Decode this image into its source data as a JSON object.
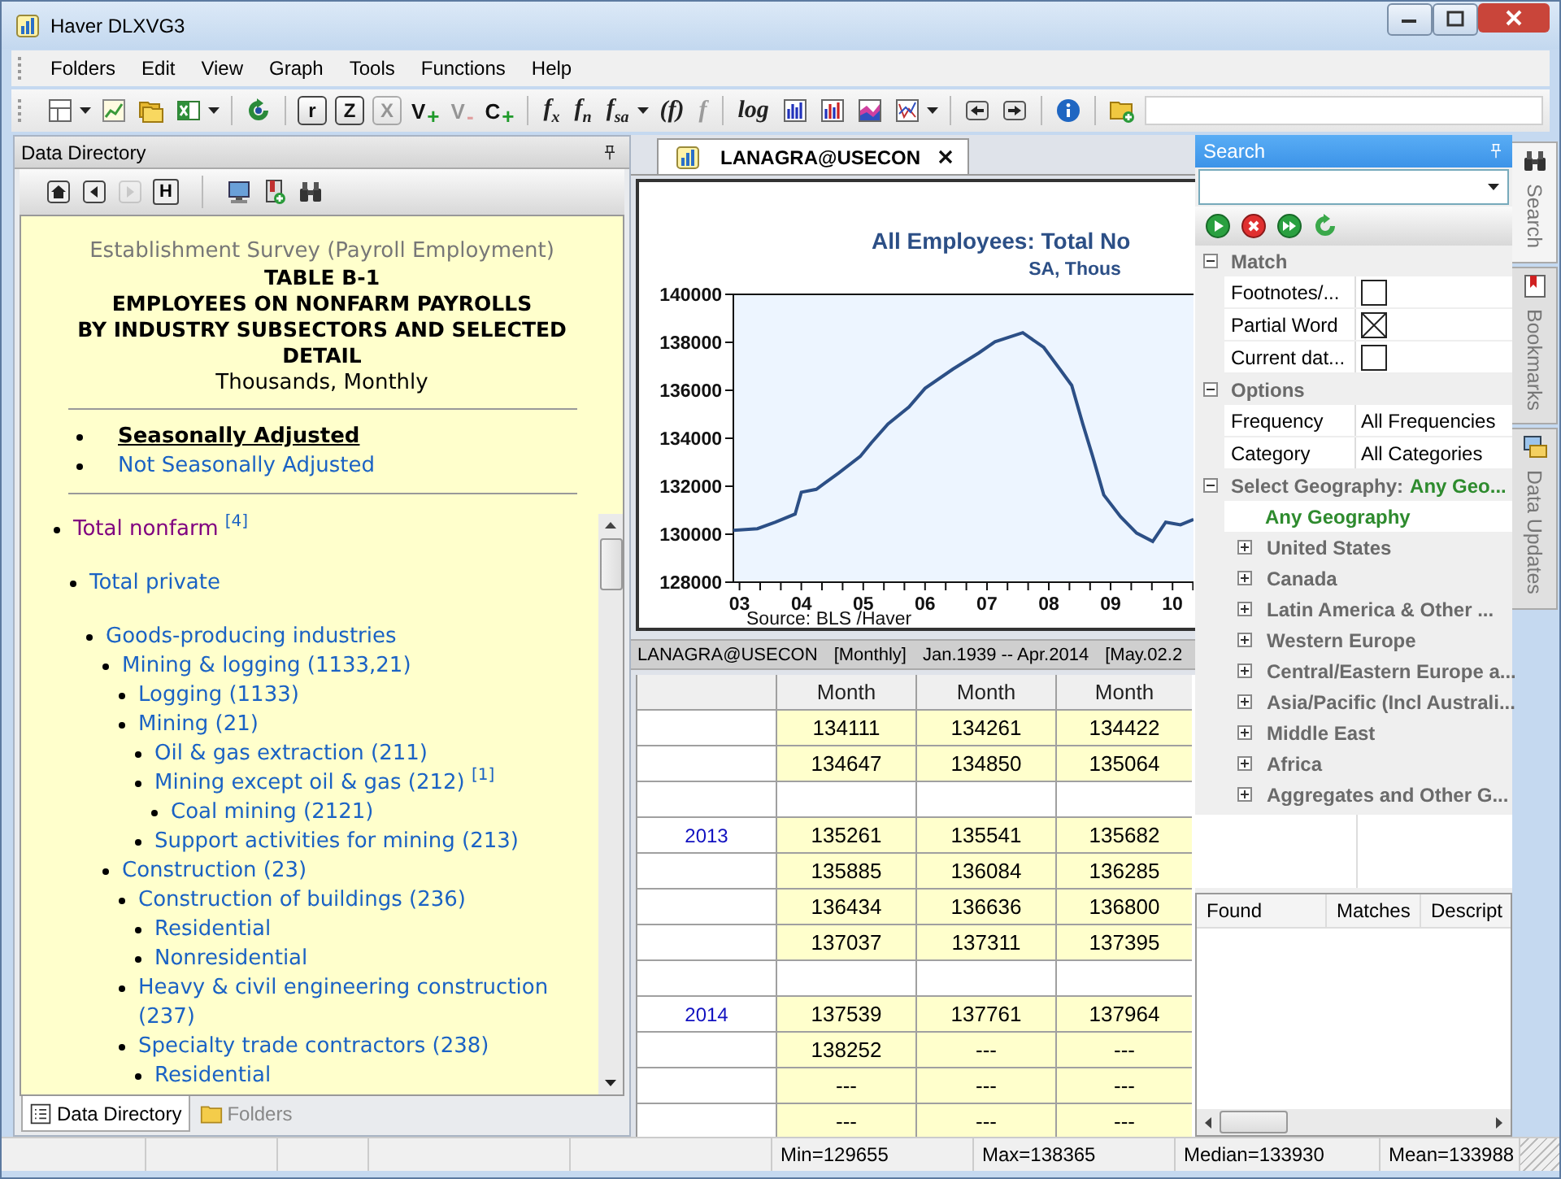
{
  "window": {
    "title": "Haver DLXVG3"
  },
  "menu": [
    "Folders",
    "Edit",
    "View",
    "Graph",
    "Tools",
    "Functions",
    "Help"
  ],
  "toolbar": [
    {
      "kind": "icon",
      "caret": true,
      "disabled": false
    },
    {
      "kind": "icon",
      "caret": false,
      "disabled": false
    },
    {
      "kind": "icon",
      "caret": false,
      "disabled": false
    },
    {
      "kind": "icon",
      "caret": true,
      "disabled": false
    },
    {
      "kind": "separator"
    },
    {
      "kind": "icon",
      "caret": false,
      "disabled": false
    },
    {
      "kind": "separator"
    },
    {
      "kind": "key",
      "label": "r",
      "caret": false,
      "disabled": false
    },
    {
      "kind": "key",
      "label": "Z",
      "caret": false,
      "disabled": false
    },
    {
      "kind": "key",
      "label": "X",
      "caret": false,
      "disabled": true
    },
    {
      "kind": "sign",
      "label": "V",
      "sign": "+",
      "caret": false,
      "disabled": false
    },
    {
      "kind": "sign",
      "label": "V",
      "sign": "-",
      "caret": false,
      "disabled": true
    },
    {
      "kind": "sign",
      "label": "C",
      "sign": "+",
      "caret": false,
      "disabled": false
    },
    {
      "kind": "separator"
    },
    {
      "kind": "func",
      "label": "f$_{x}$",
      "caret": false,
      "disabled": false
    },
    {
      "kind": "func",
      "label": "f$_{n}$",
      "caret": false,
      "disabled": false
    },
    {
      "kind": "func",
      "label": "f$_{sa}$",
      "caret": true,
      "disabled": false
    },
    {
      "kind": "func",
      "label": "(f)",
      "caret": false,
      "disabled": false
    },
    {
      "kind": "func",
      "label": "f",
      "caret": false,
      "disabled": true
    },
    {
      "kind": "separator"
    },
    {
      "kind": "func",
      "label": "log",
      "caret": false,
      "disabled": false
    },
    {
      "kind": "icon",
      "caret": false,
      "disabled": false
    },
    {
      "kind": "icon",
      "caret": false,
      "disabled": false
    },
    {
      "kind": "icon",
      "caret": false,
      "disabled": false
    },
    {
      "kind": "icon",
      "caret": true,
      "disabled": false
    },
    {
      "kind": "separator"
    },
    {
      "kind": "icon",
      "caret": false,
      "disabled": false
    },
    {
      "kind": "icon",
      "caret": false,
      "disabled": false
    },
    {
      "kind": "separator"
    },
    {
      "kind": "icon",
      "caret": false,
      "disabled": false
    },
    {
      "kind": "separator"
    },
    {
      "kind": "icon",
      "caret": false,
      "disabled": false
    }
  ],
  "data_directory": {
    "title": "Data Directory",
    "nav": [
      {
        "kind": "icon",
        "disabled": false
      },
      {
        "kind": "icon",
        "disabled": false
      },
      {
        "kind": "icon",
        "disabled": true
      },
      {
        "kind": "key",
        "label": "H",
        "disabled": false
      },
      {
        "kind": "separator"
      },
      {
        "kind": "icon",
        "disabled": false
      },
      {
        "kind": "icon",
        "disabled": false
      },
      {
        "kind": "icon",
        "disabled": false
      }
    ],
    "survey": "Establishment Survey (Payroll Employment)",
    "heading": [
      "TABLE B-1",
      "EMPLOYEES ON NONFARM PAYROLLS",
      "BY INDUSTRY SUBSECTORS AND SELECTED DETAIL"
    ],
    "units": "Thousands, Monthly",
    "adjustments": [
      {
        "label": "Seasonally Adjusted",
        "selected": true
      },
      {
        "label": "Not Seasonally Adjusted",
        "selected": false
      }
    ],
    "tree": [
      {
        "label": "Total nonfarm $^{[4]}$",
        "visited": true,
        "children": [
          {
            "label": "Total private",
            "visited": false,
            "children": [
              {
                "label": "Goods-producing industries",
                "visited": false,
                "children": [
                  {
                    "label": "Mining & logging (1133,21)",
                    "visited": false,
                    "children": [
                      {
                        "label": "Logging (1133)",
                        "visited": false
                      },
                      {
                        "label": "Mining (21)",
                        "visited": false,
                        "children": [
                          {
                            "label": "Oil & gas extraction (211)",
                            "visited": false
                          },
                          {
                            "label": "Mining except oil & gas (212) $^{[1]}$",
                            "visited": false,
                            "children": [
                              {
                                "label": "Coal mining (2121)",
                                "visited": false
                              }
                            ]
                          },
                          {
                            "label": "Support activities for mining (213)",
                            "visited": false
                          }
                        ]
                      }
                    ]
                  },
                  {
                    "label": "Construction (23)",
                    "visited": false,
                    "children": [
                      {
                        "label": "Construction of buildings (236)",
                        "visited": false,
                        "children": [
                          {
                            "label": "Residential",
                            "visited": false
                          },
                          {
                            "label": "Nonresidential",
                            "visited": false
                          }
                        ]
                      },
                      {
                        "label": "Heavy & civil engineering construction (237)",
                        "visited": false
                      },
                      {
                        "label": "Specialty trade contractors (238)",
                        "visited": false,
                        "children": [
                          {
                            "label": "Residential",
                            "visited": false
                          }
                        ]
                      }
                    ]
                  }
                ]
              }
            ]
          }
        ]
      }
    ],
    "panel_tabs": [
      {
        "label": "Data Directory",
        "selected": true
      },
      {
        "label": "Folders",
        "selected": false
      }
    ]
  },
  "series_tab": {
    "label": "LANAGRA@USECON",
    "selected": true
  },
  "chart": {
    "subtitle": "SA, Thous",
    "source": "Source:  BLS /Haver",
    "chart_data": {
      "type": "line",
      "title": "All Employees: Total No",
      "x": [
        2.9,
        3.29,
        3.58,
        3.9,
        4.0,
        4.24,
        4.6,
        4.95,
        5.13,
        5.4,
        5.74,
        6.0,
        6.45,
        6.87,
        7.13,
        7.58,
        7.92,
        8.18,
        8.37,
        8.55,
        8.71,
        8.89,
        9.16,
        9.42,
        9.68,
        9.89,
        10.13,
        10.34
      ],
      "values": [
        130160,
        130230,
        130500,
        130840,
        131750,
        131870,
        132550,
        133240,
        133800,
        134600,
        135300,
        136080,
        136880,
        137560,
        138020,
        138400,
        137790,
        136880,
        136200,
        134600,
        133240,
        131640,
        130730,
        130050,
        129700,
        130500,
        130390,
        130620
      ],
      "xlim": [
        2.9,
        10.34
      ],
      "ylim": [
        128000,
        140000
      ],
      "xticks": [
        {
          "value": 3,
          "label": "03"
        },
        {
          "value": 4,
          "label": "04"
        },
        {
          "value": 5,
          "label": "05"
        },
        {
          "value": 6,
          "label": "06"
        },
        {
          "value": 7,
          "label": "07"
        },
        {
          "value": 8,
          "label": "08"
        },
        {
          "value": 9,
          "label": "09"
        },
        {
          "value": 10,
          "label": "10"
        }
      ],
      "yticks": [
        128000,
        130000,
        132000,
        134000,
        136000,
        138000,
        140000
      ]
    }
  },
  "table": {
    "info": [
      "LANAGRA@USECON",
      "[Monthly]",
      "Jan.1939 -- Apr.2014",
      "[May.02.2"
    ],
    "columns": [
      "Month",
      "Month",
      "Month"
    ],
    "rows": [
      {
        "kind": "data",
        "cells": [
          "134111",
          "134261",
          "134422"
        ]
      },
      {
        "kind": "data",
        "cells": [
          "134647",
          "134850",
          "135064"
        ]
      },
      {
        "kind": "gap"
      },
      {
        "kind": "data",
        "label": "2013",
        "cells": [
          "135261",
          "135541",
          "135682"
        ]
      },
      {
        "kind": "data",
        "cells": [
          "135885",
          "136084",
          "136285"
        ]
      },
      {
        "kind": "data",
        "cells": [
          "136434",
          "136636",
          "136800"
        ]
      },
      {
        "kind": "data",
        "cells": [
          "137037",
          "137311",
          "137395"
        ]
      },
      {
        "kind": "gap"
      },
      {
        "kind": "data",
        "label": "2014",
        "cells": [
          "137539",
          "137761",
          "137964"
        ]
      },
      {
        "kind": "data",
        "cells": [
          "138252",
          "---",
          "---"
        ]
      },
      {
        "kind": "data",
        "cells": [
          "---",
          "---",
          "---"
        ]
      },
      {
        "kind": "data",
        "cells": [
          "---",
          "---",
          "---"
        ]
      }
    ]
  },
  "search": {
    "title": "Search",
    "groups": [
      {
        "label": "Match",
        "expanded": true,
        "rows": [
          {
            "kind": "check",
            "label": "Footnotes/...",
            "checked": false
          },
          {
            "kind": "check",
            "label": "Partial Word",
            "checked": true
          },
          {
            "kind": "check",
            "label": "Current dat...",
            "checked": false
          }
        ]
      },
      {
        "label": "Options",
        "expanded": true,
        "rows": [
          {
            "kind": "value",
            "label": "Frequency",
            "value": "All Frequencies"
          },
          {
            "kind": "value",
            "label": "Category",
            "value": "All Categories"
          }
        ]
      },
      {
        "label": "Select Geography:",
        "value": "Any Geo...",
        "expanded": true,
        "rows": [
          {
            "kind": "choice",
            "label": "Any Geography",
            "selected": true
          },
          {
            "kind": "node",
            "label": "United States",
            "expanded": false
          },
          {
            "kind": "node",
            "label": "Canada",
            "expanded": false
          },
          {
            "kind": "node",
            "label": "Latin America & Other ...",
            "expanded": false
          },
          {
            "kind": "node",
            "label": "Western Europe",
            "expanded": false
          },
          {
            "kind": "node",
            "label": "Central/Eastern Europe a...",
            "expanded": false
          },
          {
            "kind": "node",
            "label": "Asia/Pacific (Incl Australi...",
            "expanded": false
          },
          {
            "kind": "node",
            "label": "Middle East",
            "expanded": false
          },
          {
            "kind": "node",
            "label": "Africa",
            "expanded": false
          },
          {
            "kind": "node",
            "label": "Aggregates and Other G...",
            "expanded": false
          }
        ]
      }
    ],
    "results": {
      "columns": [
        "Found",
        "Matches",
        "Descript"
      ]
    }
  },
  "side_tabs": [
    {
      "label": "Search",
      "selected": true
    },
    {
      "label": "Bookmarks",
      "selected": false
    },
    {
      "label": "Data Updates",
      "selected": false
    }
  ],
  "status_bar": [
    "Min=129655",
    "Max=138365",
    "Median=133930",
    "Mean=133988"
  ]
}
